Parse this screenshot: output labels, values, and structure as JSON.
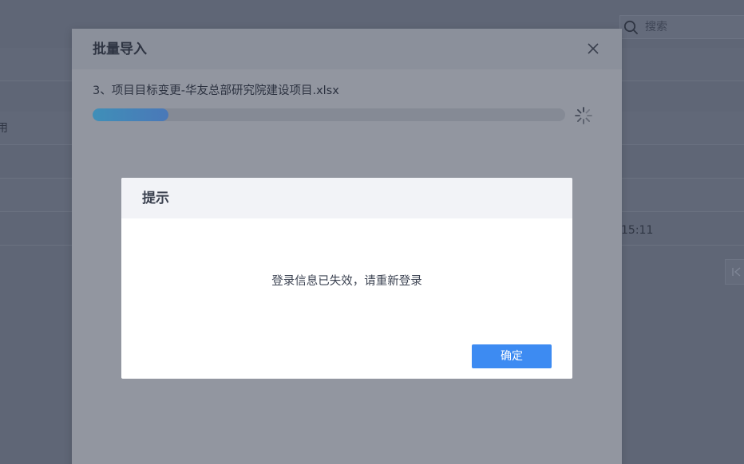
{
  "background": {
    "search": {
      "placeholder": "搜索",
      "icon": "search-icon"
    },
    "row_snippets": {
      "left_partial": "用",
      "time_partial": "15:11"
    },
    "pager": {
      "icon": "first-page-icon"
    }
  },
  "import_dialog": {
    "title": "批量导入",
    "close_icon": "close-icon",
    "file_name": "3、项目目标变更-华友总部研究院建设项目.xlsx",
    "progress_fraction": 0.16,
    "spinner_icon": "loading-spinner-icon"
  },
  "alert": {
    "title": "提示",
    "message": "登录信息已失效，请重新登录",
    "confirm_label": "确定"
  },
  "colors": {
    "accent": "#3d8bf2",
    "progress": "#4a86b8",
    "overlay": "#5f6676"
  }
}
